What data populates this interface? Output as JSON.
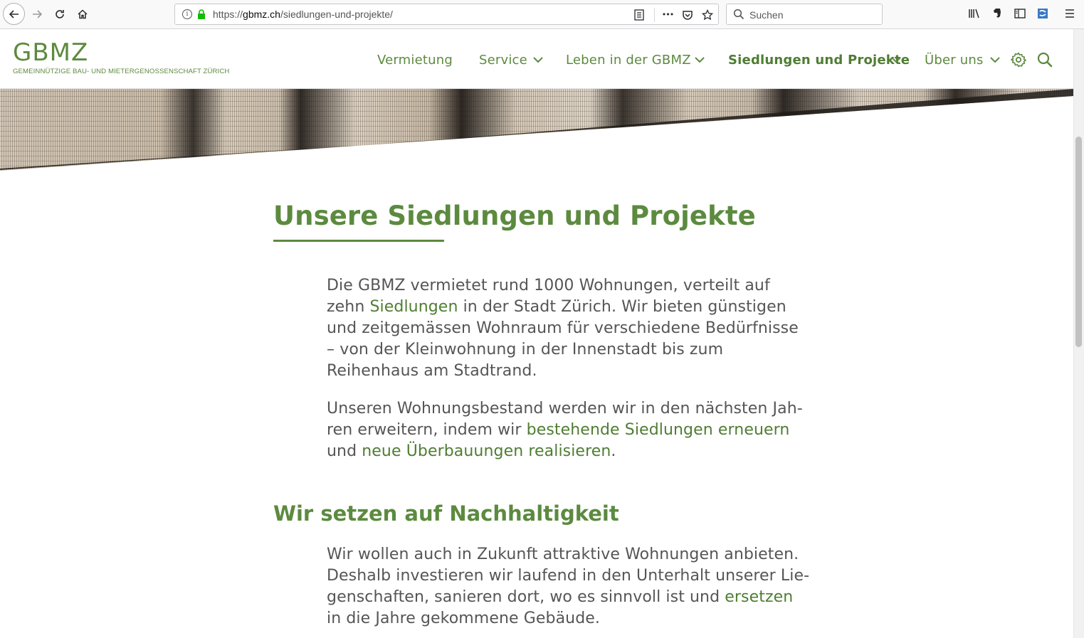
{
  "browser": {
    "url_proto": "https://",
    "url_host": "gbmz.ch",
    "url_path": "/siedlungen-und-projekte/",
    "search_placeholder": "Suchen",
    "overflow_glyph": "•••"
  },
  "site": {
    "logo_word": "GBMZ",
    "logo_subtitle": "GEMEINNÜTZIGE BAU- UND MIETERGENOSSENSCHAFT ZÜRICH",
    "accent_color": "#5c8a3f",
    "nav": [
      {
        "label": "Vermietung"
      },
      {
        "label": "Service"
      },
      {
        "label": "Leben in der GBMZ"
      },
      {
        "label": "Siedlungen und Projekte"
      },
      {
        "label": "Über uns"
      }
    ]
  },
  "content": {
    "title": "Unsere Siedlungen und Projekte",
    "p1": {
      "t1": "Die GBMZ vermietet rund 1000 Wohnungen, verteilt auf zehn ",
      "link1": "Siedlungen",
      "t2": " in der Stadt Zürich. Wir bieten günstigen und zeitgemässen Wohnraum für verschiedene Bedürfnisse – von der Kleinwohnung in der Innenstadt bis zum Reihenhaus am Stadtrand."
    },
    "p2": {
      "t1": "Unseren Wohnungsbestand werden wir in den nächsten Jah­ren erweitern, indem wir ",
      "link1": "bestehende Siedlungen erneuern",
      "t2": " und ",
      "link2": "neue Überbauungen realisieren",
      "t3": "."
    },
    "subtitle": "Wir setzen auf Nachhaltigkeit",
    "p3": {
      "t1": "Wir wollen auch in Zukunft attraktive Wohnungen anbieten. Deshalb investieren wir laufend in den Unterhalt unserer Lie­genschaften, sanieren dort, wo es sinnvoll ist und ",
      "link1": "ersetzen",
      "t2": " in die Jahre gekommene Gebäude."
    }
  }
}
